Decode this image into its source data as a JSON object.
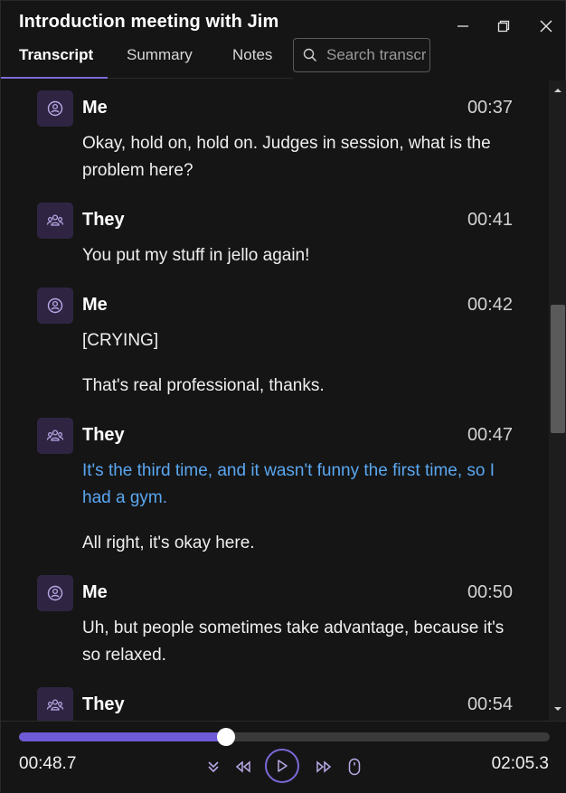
{
  "window": {
    "title": "Introduction meeting with Jim"
  },
  "tabs": [
    {
      "label": "Transcript",
      "active": true
    },
    {
      "label": "Summary",
      "active": false
    },
    {
      "label": "Notes",
      "active": false
    }
  ],
  "search": {
    "placeholder": "Search transcript"
  },
  "transcript": [
    {
      "speaker": "Me",
      "icon": "person-icon",
      "time": "00:37",
      "lines": [
        {
          "text": "Okay, hold on, hold on. Judges in session, what is the problem here?",
          "highlight": false
        }
      ]
    },
    {
      "speaker": "They",
      "icon": "people-icon",
      "time": "00:41",
      "lines": [
        {
          "text": "You put my stuff in jello again!",
          "highlight": false
        }
      ]
    },
    {
      "speaker": "Me",
      "icon": "person-icon",
      "time": "00:42",
      "lines": [
        {
          "text": "[CRYING]",
          "highlight": false
        },
        {
          "text": "That's real professional, thanks.",
          "highlight": false
        }
      ]
    },
    {
      "speaker": "They",
      "icon": "people-icon",
      "time": "00:47",
      "lines": [
        {
          "text": "It's the third time, and it wasn't funny the first time, so I had a gym.",
          "highlight": true
        },
        {
          "text": "All right, it's okay here.",
          "highlight": false
        }
      ]
    },
    {
      "speaker": "Me",
      "icon": "person-icon",
      "time": "00:50",
      "lines": [
        {
          "text": "Uh, but people sometimes take advantage, because it's so relaxed.",
          "highlight": false
        }
      ]
    },
    {
      "speaker": "They",
      "icon": "people-icon",
      "time": "00:54",
      "lines": []
    }
  ],
  "player": {
    "current_time": "00:48.7",
    "total_time": "02:05.3",
    "progress": 0.39
  },
  "colors": {
    "accent": "#6e5bd5",
    "highlight_text": "#5aa7f0",
    "avatar_bg": "#2f2543"
  }
}
